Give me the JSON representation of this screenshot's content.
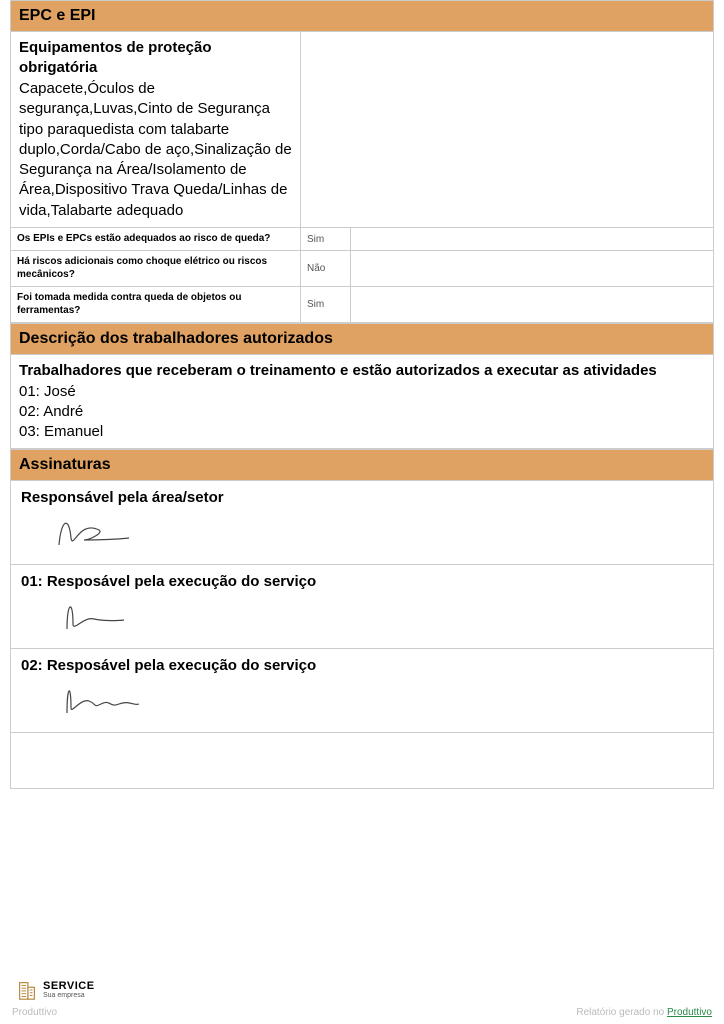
{
  "epc": {
    "header": "EPC e EPI",
    "equip_title": "Equipamentos de proteção obrigatória",
    "equip_body": "Capacete,Óculos de segurança,Luvas,Cinto de Segurança tipo paraquedista com talabarte duplo,Corda/Cabo de aço,Sinalização de Segurança na Área/Isolamento de Área,Dispositivo Trava Queda/Linhas de vida,Talabarte adequado",
    "qa": [
      {
        "q": "Os EPIs e EPCs estão adequados ao risco de queda?",
        "a": "Sim"
      },
      {
        "q": "Há riscos adicionais como choque elétrico ou riscos mecânicos?",
        "a": "Não"
      },
      {
        "q": "Foi tomada medida contra queda de objetos ou ferramentas?",
        "a": "Sim"
      }
    ]
  },
  "workers": {
    "header": "Descrição dos trabalhadores autorizados",
    "title": "Trabalhadores que receberam o treinamento e estão autorizados a executar as atividades",
    "list": [
      "01: José",
      "02: André",
      "03: Emanuel"
    ]
  },
  "signatures": {
    "header": "Assinaturas",
    "blocks": [
      {
        "title": "Responsável pela área/setor"
      },
      {
        "title": "01: Resposável pela execução do serviço"
      },
      {
        "title": "02: Resposável pela execução do serviço"
      }
    ]
  },
  "footer": {
    "logo_big": "SERVICE",
    "logo_small": "Sua empresa",
    "left": "Produttivo",
    "right_prefix": "Relatório gerado no ",
    "right_link": "Produttivo"
  }
}
